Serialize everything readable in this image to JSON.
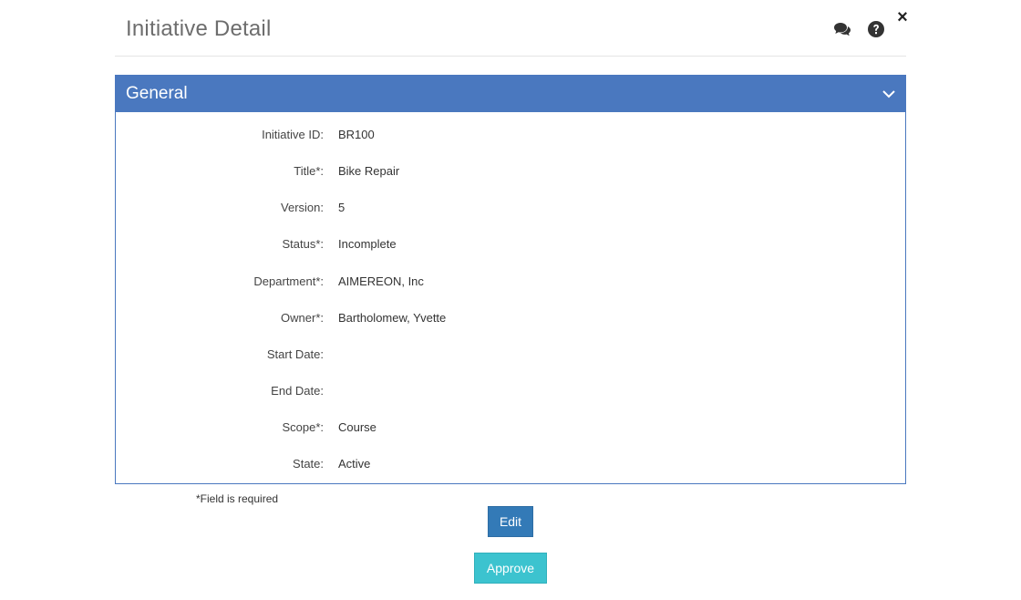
{
  "header": {
    "title": "Initiative Detail",
    "icons": [
      "comments-icon",
      "help-icon",
      "close-icon"
    ],
    "close_glyph": "×"
  },
  "panel": {
    "title": "General",
    "accent_color": "#4a78bf",
    "fields": [
      {
        "label": "Initiative ID:",
        "value": "BR100"
      },
      {
        "label": "Title*:",
        "value": "Bike Repair"
      },
      {
        "label": "Version:",
        "value": "5"
      },
      {
        "label": "Status*:",
        "value": "Incomplete"
      },
      {
        "label": "Department*:",
        "value": "AIMEREON, Inc"
      },
      {
        "label": "Owner*:",
        "value": "Bartholomew, Yvette"
      },
      {
        "label": "Start Date:",
        "value": ""
      },
      {
        "label": "End Date:",
        "value": ""
      },
      {
        "label": "Scope*:",
        "value": "Course"
      },
      {
        "label": "State:",
        "value": "Active"
      }
    ]
  },
  "footer": {
    "required_note": "*Field is required",
    "edit_label": "Edit",
    "approve_label": "Approve",
    "edit_color": "#337ab7",
    "approve_color": "#3cc3cf"
  }
}
